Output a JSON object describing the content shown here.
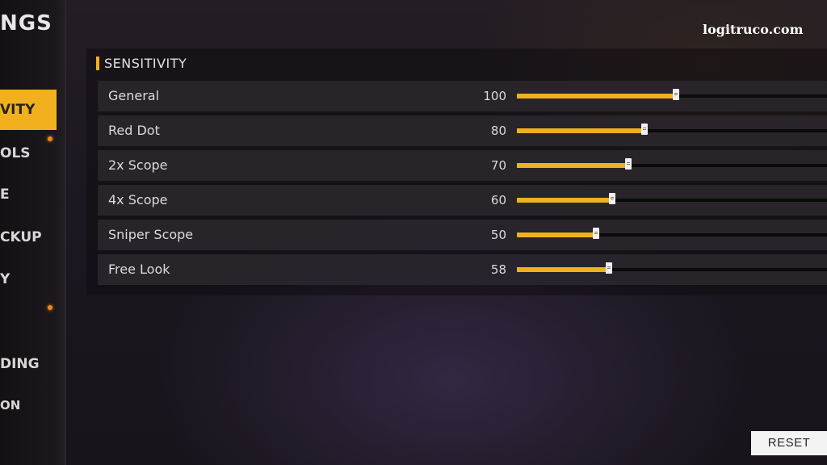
{
  "sidebar": {
    "title": "NGS",
    "items": [
      {
        "label": "VITY",
        "active": true,
        "dot": false
      },
      {
        "label": "OLS",
        "active": false,
        "dot": true
      },
      {
        "label": "E",
        "active": false,
        "dot": false
      },
      {
        "label": "CKUP",
        "active": false,
        "dot": false
      },
      {
        "label": "Y",
        "active": false,
        "dot": false
      },
      {
        "label": "",
        "active": false,
        "dot": true
      },
      {
        "label": "",
        "active": false,
        "dot": false
      },
      {
        "label": "DING",
        "active": false,
        "dot": false
      },
      {
        "label": "ON",
        "active": false,
        "dot": false
      }
    ]
  },
  "section": {
    "title": "SENSITIVITY"
  },
  "sensitivity": [
    {
      "label": "General",
      "value": 100
    },
    {
      "label": "Red Dot",
      "value": 80
    },
    {
      "label": "2x Scope",
      "value": 70
    },
    {
      "label": "4x Scope",
      "value": 60
    },
    {
      "label": "Sniper Scope",
      "value": 50
    },
    {
      "label": "Free Look",
      "value": 58
    }
  ],
  "slider_max": 195,
  "watermark": "logitruco.com",
  "reset_label": "RESET",
  "colors": {
    "accent": "#f2b01e",
    "dot": "#f08a1a"
  }
}
